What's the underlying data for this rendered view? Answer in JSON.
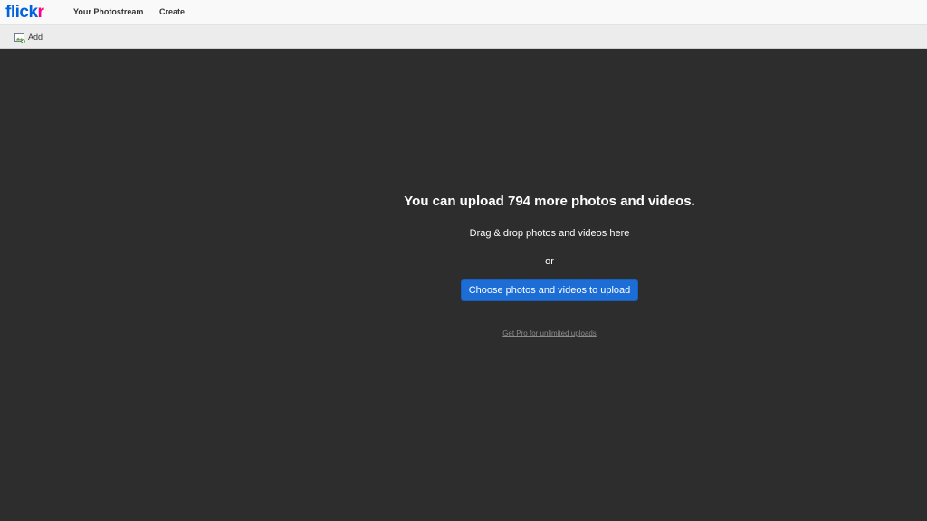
{
  "header": {
    "logo_main": "flick",
    "logo_accent": "r",
    "nav": [
      {
        "label": "Your Photostream"
      },
      {
        "label": "Create"
      }
    ]
  },
  "toolbar": {
    "add_label": "Add",
    "add_icon": "add-photo-icon"
  },
  "upload": {
    "headline": "You can upload 794 more photos and videos.",
    "drag_text": "Drag & drop photos and videos here",
    "or_text": "or",
    "choose_button": "Choose photos and videos to upload",
    "pro_link": "Get Pro for unlimited uploads"
  },
  "colors": {
    "logo_blue": "#0063dc",
    "logo_pink": "#ff0084",
    "stage_bg": "#2d2d2d",
    "button_blue": "#1c6ed6"
  }
}
